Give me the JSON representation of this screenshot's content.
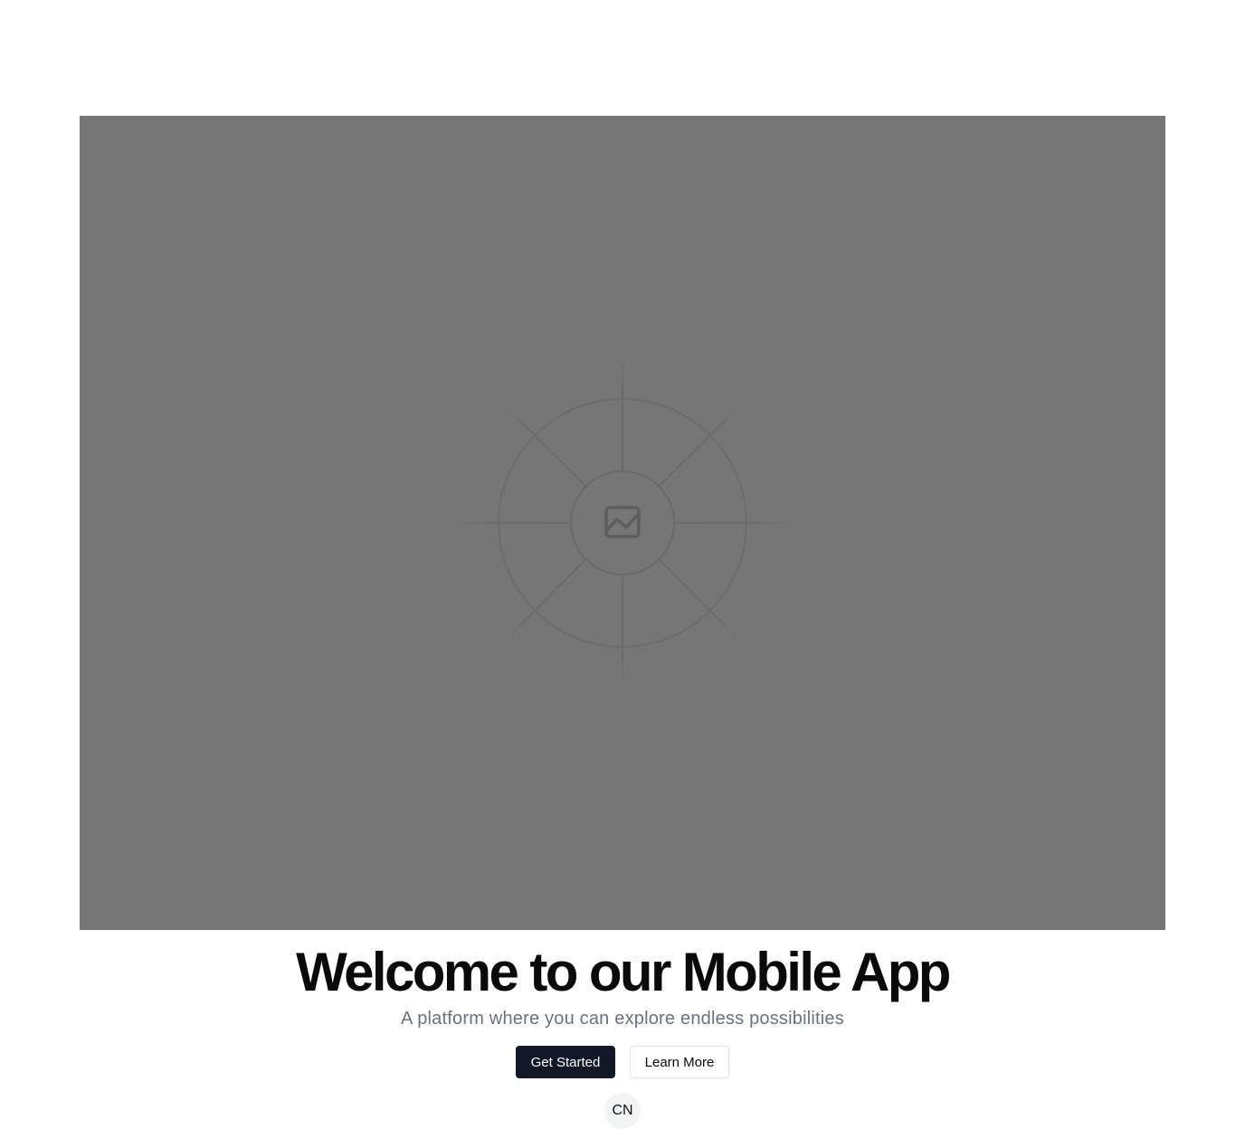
{
  "hero": {
    "image_icon": "image-placeholder-icon",
    "background_color": "#767676"
  },
  "title": "Welcome to our Mobile App",
  "subtitle": "A platform where you can explore endless possibilities",
  "actions": {
    "primary_label": "Get Started",
    "secondary_label": "Learn More"
  },
  "avatar": {
    "initials": "CN"
  },
  "colors": {
    "primary_button": "#111827",
    "subtitle_text": "#6b7280"
  }
}
